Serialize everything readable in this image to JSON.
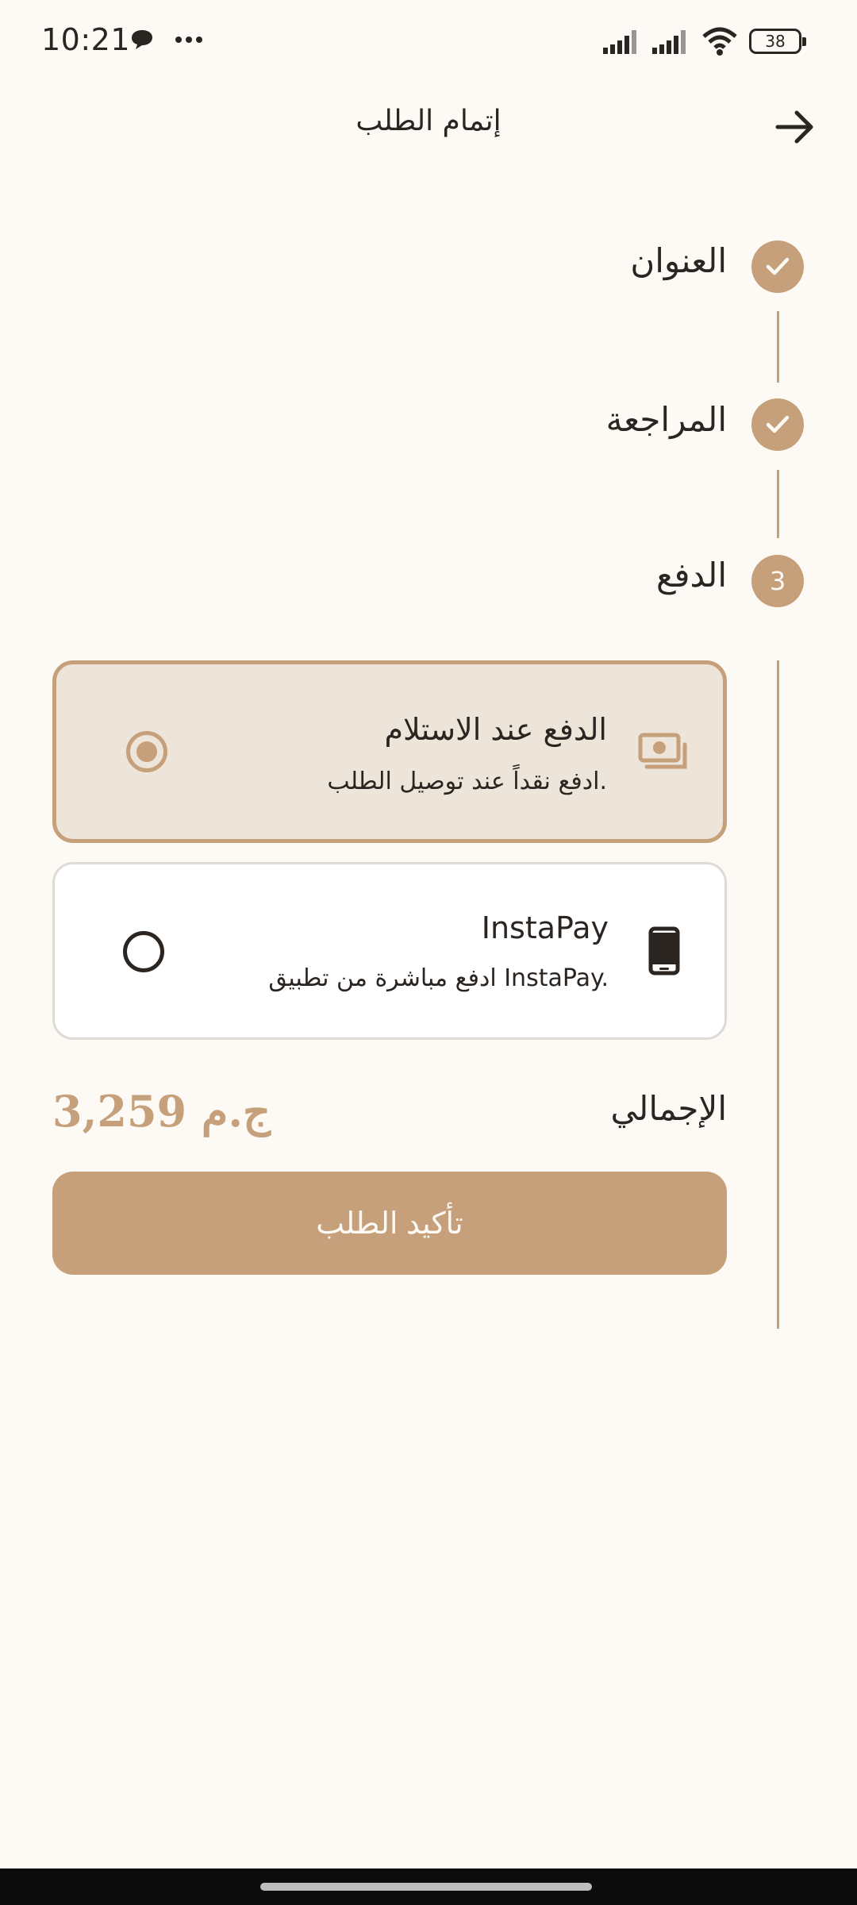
{
  "status_bar": {
    "time": "10:21",
    "battery": "38",
    "icons": [
      "chat-bubble-icon",
      "more-dots-icon",
      "signal-icon",
      "signal-icon",
      "wifi-icon",
      "battery-icon"
    ]
  },
  "header": {
    "title": "إتمام الطلب",
    "back_icon": "arrow-right-icon"
  },
  "stepper": {
    "steps": [
      {
        "label": "العنوان",
        "state": "done",
        "icon": "check-icon"
      },
      {
        "label": "المراجعة",
        "state": "done",
        "icon": "check-icon"
      },
      {
        "label": "الدفع",
        "state": "active",
        "number": "3"
      }
    ]
  },
  "payment": {
    "options": [
      {
        "title": "الدفع عند الاستلام",
        "description": "ادفع نقداً عند توصيل الطلب.",
        "icon": "cash-icon",
        "selected": true
      },
      {
        "title": "InstaPay",
        "description": "ادفع مباشرة من تطبيق InstaPay.",
        "icon": "phone-icon",
        "selected": false
      }
    ]
  },
  "total": {
    "label": "الإجمالي",
    "value": "3,259 ج.م"
  },
  "confirm_button": {
    "label": "تأكيد الطلب"
  },
  "colors": {
    "accent": "#c6a07a",
    "background": "#fdfaf5",
    "selected_card": "#ede4da",
    "text": "#2b2522"
  }
}
